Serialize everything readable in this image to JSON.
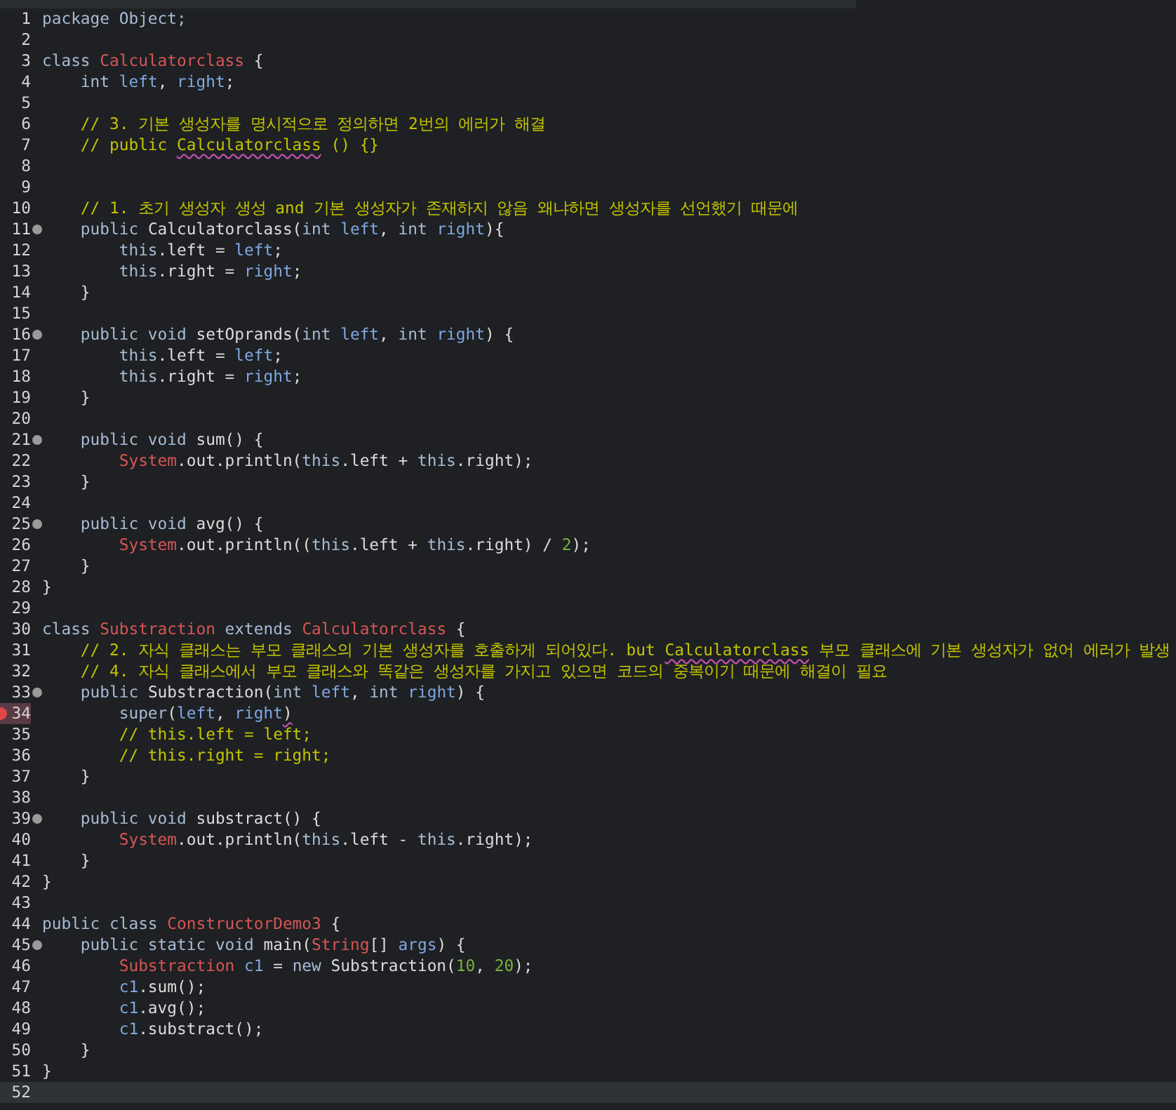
{
  "editor": {
    "lines": [
      {
        "number": "1",
        "tokens": [
          {
            "kind": "k",
            "text": "package Object;"
          }
        ]
      },
      {
        "number": "2"
      },
      {
        "number": "3",
        "tokens": [
          {
            "kind": "k",
            "text": "class "
          },
          {
            "kind": "c",
            "text": "Calculatorclass"
          },
          {
            "kind": "p",
            "text": " {"
          }
        ]
      },
      {
        "number": "4",
        "tokens": [
          {
            "kind": "k",
            "text": "    int "
          },
          {
            "kind": "v",
            "text": "left"
          },
          {
            "kind": "p",
            "text": ", "
          },
          {
            "kind": "v",
            "text": "right"
          },
          {
            "kind": "p",
            "text": ";"
          }
        ]
      },
      {
        "number": "5"
      },
      {
        "number": "6",
        "tokens": [
          {
            "kind": "m",
            "text": "    // 3. 기본 생성자를 명시적으로 정의하면 2번의 에러가 해결"
          }
        ]
      },
      {
        "number": "7",
        "tokens": [
          {
            "kind": "m",
            "text": "    // public "
          },
          {
            "kind": "m",
            "text": "Calculatorclass",
            "error": true
          },
          {
            "kind": "m",
            "text": " () {}"
          }
        ]
      },
      {
        "number": "8"
      },
      {
        "number": "9"
      },
      {
        "number": "10",
        "tokens": [
          {
            "kind": "m",
            "text": "    // 1. 초기 생성자 생성 and 기본 생성자가 존재하지 않음 왜냐하면 생성자를 선언했기 때문에"
          }
        ]
      },
      {
        "number": "11",
        "fold": true,
        "tokens": [
          {
            "kind": "k",
            "text": "    public "
          },
          {
            "kind": "p",
            "text": "Calculatorclass("
          },
          {
            "kind": "k",
            "text": "int "
          },
          {
            "kind": "v",
            "text": "left"
          },
          {
            "kind": "p",
            "text": ", "
          },
          {
            "kind": "k",
            "text": "int "
          },
          {
            "kind": "v",
            "text": "right"
          },
          {
            "kind": "p",
            "text": "){"
          }
        ]
      },
      {
        "number": "12",
        "tokens": [
          {
            "kind": "k",
            "text": "        this"
          },
          {
            "kind": "p",
            "text": ".left = "
          },
          {
            "kind": "v",
            "text": "left"
          },
          {
            "kind": "p",
            "text": ";"
          }
        ]
      },
      {
        "number": "13",
        "tokens": [
          {
            "kind": "k",
            "text": "        this"
          },
          {
            "kind": "p",
            "text": ".right = "
          },
          {
            "kind": "v",
            "text": "right"
          },
          {
            "kind": "p",
            "text": ";"
          }
        ]
      },
      {
        "number": "14",
        "tokens": [
          {
            "kind": "p",
            "text": "    }"
          }
        ]
      },
      {
        "number": "15"
      },
      {
        "number": "16",
        "fold": true,
        "tokens": [
          {
            "kind": "k",
            "text": "    public void "
          },
          {
            "kind": "p",
            "text": "setOprands("
          },
          {
            "kind": "k",
            "text": "int "
          },
          {
            "kind": "v",
            "text": "left"
          },
          {
            "kind": "p",
            "text": ", "
          },
          {
            "kind": "k",
            "text": "int "
          },
          {
            "kind": "v",
            "text": "right"
          },
          {
            "kind": "p",
            "text": ") {"
          }
        ]
      },
      {
        "number": "17",
        "tokens": [
          {
            "kind": "k",
            "text": "        this"
          },
          {
            "kind": "p",
            "text": ".left = "
          },
          {
            "kind": "v",
            "text": "left"
          },
          {
            "kind": "p",
            "text": ";"
          }
        ]
      },
      {
        "number": "18",
        "tokens": [
          {
            "kind": "k",
            "text": "        this"
          },
          {
            "kind": "p",
            "text": ".right = "
          },
          {
            "kind": "v",
            "text": "right"
          },
          {
            "kind": "p",
            "text": ";"
          }
        ]
      },
      {
        "number": "19",
        "tokens": [
          {
            "kind": "p",
            "text": "    }"
          }
        ]
      },
      {
        "number": "20"
      },
      {
        "number": "21",
        "fold": true,
        "tokens": [
          {
            "kind": "k",
            "text": "    public void "
          },
          {
            "kind": "p",
            "text": "sum() {"
          }
        ]
      },
      {
        "number": "22",
        "tokens": [
          {
            "kind": "c",
            "text": "        System"
          },
          {
            "kind": "p",
            "text": ".out.println("
          },
          {
            "kind": "k",
            "text": "this"
          },
          {
            "kind": "p",
            "text": ".left + "
          },
          {
            "kind": "k",
            "text": "this"
          },
          {
            "kind": "p",
            "text": ".right);"
          }
        ]
      },
      {
        "number": "23",
        "tokens": [
          {
            "kind": "p",
            "text": "    }"
          }
        ]
      },
      {
        "number": "24"
      },
      {
        "number": "25",
        "fold": true,
        "tokens": [
          {
            "kind": "k",
            "text": "    public void "
          },
          {
            "kind": "p",
            "text": "avg() {"
          }
        ]
      },
      {
        "number": "26",
        "tokens": [
          {
            "kind": "c",
            "text": "        System"
          },
          {
            "kind": "p",
            "text": ".out.println(("
          },
          {
            "kind": "k",
            "text": "this"
          },
          {
            "kind": "p",
            "text": ".left + "
          },
          {
            "kind": "k",
            "text": "this"
          },
          {
            "kind": "p",
            "text": ".right) / "
          },
          {
            "kind": "n",
            "text": "2"
          },
          {
            "kind": "p",
            "text": ");"
          }
        ]
      },
      {
        "number": "27",
        "tokens": [
          {
            "kind": "p",
            "text": "    }"
          }
        ]
      },
      {
        "number": "28",
        "tokens": [
          {
            "kind": "p",
            "text": "}"
          }
        ]
      },
      {
        "number": "29"
      },
      {
        "number": "30",
        "tokens": [
          {
            "kind": "k",
            "text": "class "
          },
          {
            "kind": "c",
            "text": "Substraction"
          },
          {
            "kind": "k",
            "text": " extends "
          },
          {
            "kind": "c",
            "text": "Calculatorclass"
          },
          {
            "kind": "p",
            "text": " {"
          }
        ]
      },
      {
        "number": "31",
        "tokens": [
          {
            "kind": "m",
            "text": "    // 2. 자식 클래스는 부모 클래스의 기본 생성자를 호출하게 되어있다. but "
          },
          {
            "kind": "m",
            "text": "Calculatorclass",
            "error": true
          },
          {
            "kind": "m",
            "text": " 부모 클래스에 기본 생성자가 없어 에러가 발생"
          }
        ]
      },
      {
        "number": "32",
        "tokens": [
          {
            "kind": "m",
            "text": "    // 4. 자식 클래스에서 부모 클래스와 똑같은 생성자를 가지고 있으면 코드의 중복이기 때문에 해결이 필요"
          }
        ]
      },
      {
        "number": "33",
        "fold": true,
        "tokens": [
          {
            "kind": "k",
            "text": "    public "
          },
          {
            "kind": "p",
            "text": "Substraction("
          },
          {
            "kind": "k",
            "text": "int "
          },
          {
            "kind": "v",
            "text": "left"
          },
          {
            "kind": "p",
            "text": ", "
          },
          {
            "kind": "k",
            "text": "int "
          },
          {
            "kind": "v",
            "text": "right"
          },
          {
            "kind": "p",
            "text": ") {"
          }
        ]
      },
      {
        "number": "34",
        "error": true,
        "tokens": [
          {
            "kind": "k",
            "text": "        super"
          },
          {
            "kind": "p",
            "text": "("
          },
          {
            "kind": "v",
            "text": "left"
          },
          {
            "kind": "p",
            "text": ", "
          },
          {
            "kind": "v",
            "text": "right"
          },
          {
            "kind": "p",
            "text": ")",
            "error": true
          }
        ]
      },
      {
        "number": "35",
        "tokens": [
          {
            "kind": "m",
            "text": "        // this.left = left;"
          }
        ]
      },
      {
        "number": "36",
        "tokens": [
          {
            "kind": "m",
            "text": "        // this.right = right;"
          }
        ]
      },
      {
        "number": "37",
        "tokens": [
          {
            "kind": "p",
            "text": "    }"
          }
        ]
      },
      {
        "number": "38"
      },
      {
        "number": "39",
        "fold": true,
        "tokens": [
          {
            "kind": "k",
            "text": "    public void "
          },
          {
            "kind": "p",
            "text": "substract() {"
          }
        ]
      },
      {
        "number": "40",
        "tokens": [
          {
            "kind": "c",
            "text": "        System"
          },
          {
            "kind": "p",
            "text": ".out.println("
          },
          {
            "kind": "k",
            "text": "this"
          },
          {
            "kind": "p",
            "text": ".left - "
          },
          {
            "kind": "k",
            "text": "this"
          },
          {
            "kind": "p",
            "text": ".right);"
          }
        ]
      },
      {
        "number": "41",
        "tokens": [
          {
            "kind": "p",
            "text": "    }"
          }
        ]
      },
      {
        "number": "42",
        "tokens": [
          {
            "kind": "p",
            "text": "}"
          }
        ]
      },
      {
        "number": "43"
      },
      {
        "number": "44",
        "tokens": [
          {
            "kind": "k",
            "text": "public class "
          },
          {
            "kind": "c",
            "text": "ConstructorDemo3"
          },
          {
            "kind": "p",
            "text": " {"
          }
        ]
      },
      {
        "number": "45",
        "fold": true,
        "tokens": [
          {
            "kind": "k",
            "text": "    public static void "
          },
          {
            "kind": "p",
            "text": "main("
          },
          {
            "kind": "c",
            "text": "String"
          },
          {
            "kind": "p",
            "text": "[] "
          },
          {
            "kind": "v",
            "text": "args"
          },
          {
            "kind": "p",
            "text": ") {"
          }
        ]
      },
      {
        "number": "46",
        "tokens": [
          {
            "kind": "c",
            "text": "        Substraction"
          },
          {
            "kind": "v",
            "text": " c1"
          },
          {
            "kind": "p",
            "text": " = "
          },
          {
            "kind": "k",
            "text": "new "
          },
          {
            "kind": "p",
            "text": "Substraction("
          },
          {
            "kind": "n",
            "text": "10"
          },
          {
            "kind": "p",
            "text": ", "
          },
          {
            "kind": "n",
            "text": "20"
          },
          {
            "kind": "p",
            "text": ");"
          }
        ]
      },
      {
        "number": "47",
        "tokens": [
          {
            "kind": "v",
            "text": "        c1"
          },
          {
            "kind": "p",
            "text": ".sum();"
          }
        ]
      },
      {
        "number": "48",
        "tokens": [
          {
            "kind": "v",
            "text": "        c1"
          },
          {
            "kind": "p",
            "text": ".avg();"
          }
        ]
      },
      {
        "number": "49",
        "tokens": [
          {
            "kind": "v",
            "text": "        c1"
          },
          {
            "kind": "p",
            "text": ".substract();"
          }
        ]
      },
      {
        "number": "50",
        "tokens": [
          {
            "kind": "p",
            "text": "    }"
          }
        ]
      },
      {
        "number": "51",
        "tokens": [
          {
            "kind": "p",
            "text": "}"
          }
        ]
      },
      {
        "number": "52",
        "current": true
      }
    ]
  }
}
